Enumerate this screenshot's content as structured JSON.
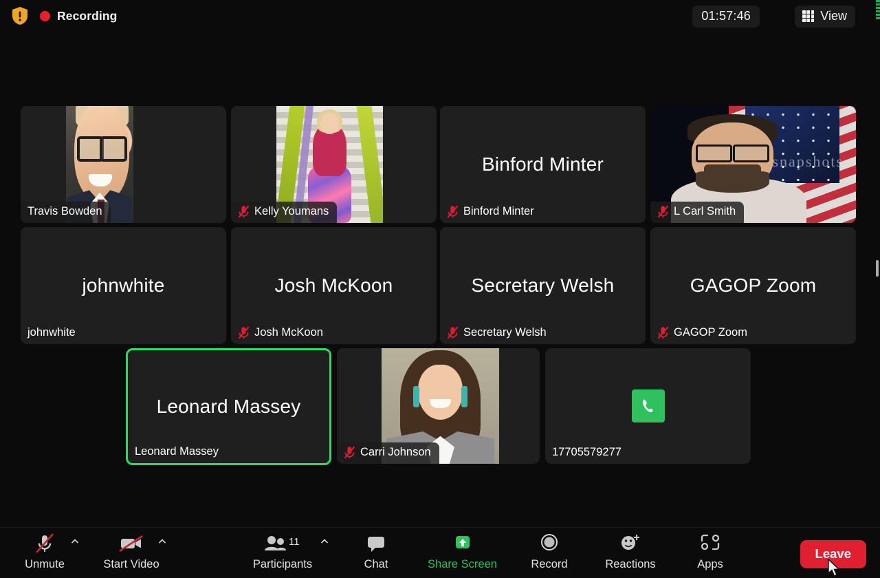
{
  "app": "Zoom Meeting",
  "topbar": {
    "shield_icon": "security-shield-icon",
    "recording_dot_icon": "recording-dot-icon",
    "recording_label": "Recording",
    "timer": "01:57:46",
    "view_label": "View",
    "view_icon": "grid-view-icon"
  },
  "colors": {
    "active_speaker_border": "#21e065",
    "mute_red": "#e02030",
    "share_green": "#2ec15d",
    "leave_red": "#e02030",
    "recording_red": "#e8202a",
    "tile_bg": "#1f1f1f",
    "app_bg": "#0b0b0b"
  },
  "gallery": {
    "participants": [
      {
        "name": "Travis Bowden",
        "display_name": "Travis Bowden",
        "big_name": "",
        "has_video": true,
        "muted": false,
        "active_speaker": false,
        "photo": "travis",
        "type": "video"
      },
      {
        "name": "Kelly Youmans",
        "display_name": "Kelly Youmans",
        "big_name": "",
        "has_video": true,
        "muted": true,
        "active_speaker": false,
        "photo": "kelly",
        "type": "video"
      },
      {
        "name": "Binford Minter",
        "display_name": "Binford Minter",
        "big_name": "Binford Minter",
        "has_video": false,
        "muted": true,
        "active_speaker": false,
        "photo": "",
        "type": "name"
      },
      {
        "name": "L Carl Smith",
        "display_name": "L Carl Smith",
        "big_name": "",
        "has_video": true,
        "muted": true,
        "active_speaker": false,
        "photo": "carl",
        "type": "video"
      },
      {
        "name": "johnwhite",
        "display_name": "johnwhite",
        "big_name": "johnwhite",
        "has_video": false,
        "muted": false,
        "active_speaker": false,
        "photo": "",
        "type": "name"
      },
      {
        "name": "Josh McKoon",
        "display_name": "Josh McKoon",
        "big_name": "Josh McKoon",
        "has_video": false,
        "muted": true,
        "active_speaker": false,
        "photo": "",
        "type": "name"
      },
      {
        "name": "Secretary Welsh",
        "display_name": "Secretary Welsh",
        "big_name": "Secretary Welsh",
        "has_video": false,
        "muted": true,
        "active_speaker": false,
        "photo": "",
        "type": "name"
      },
      {
        "name": "GAGOP Zoom",
        "display_name": "GAGOP Zoom",
        "big_name": "GAGOP Zoom",
        "has_video": false,
        "muted": true,
        "active_speaker": false,
        "photo": "",
        "type": "name"
      },
      {
        "name": "Leonard Massey",
        "display_name": "Leonard Massey",
        "big_name": "Leonard Massey",
        "has_video": false,
        "muted": false,
        "active_speaker": true,
        "photo": "",
        "type": "name"
      },
      {
        "name": "Carri Johnson",
        "display_name": "Carri Johnson",
        "big_name": "",
        "has_video": true,
        "muted": true,
        "active_speaker": false,
        "photo": "carri",
        "type": "video"
      },
      {
        "name": "17705579277",
        "display_name": "17705579277",
        "big_name": "",
        "has_video": false,
        "muted": false,
        "active_speaker": false,
        "photo": "",
        "type": "phone"
      }
    ]
  },
  "toolbar": {
    "items": [
      {
        "label": "Unmute",
        "icon": "microphone-muted-icon",
        "caret": true,
        "green": false
      },
      {
        "label": "Start Video",
        "icon": "camera-off-icon",
        "caret": true,
        "green": false
      },
      {
        "label": "Participants",
        "icon": "participants-icon",
        "caret": true,
        "green": false,
        "count": "11"
      },
      {
        "label": "Chat",
        "icon": "chat-bubble-icon",
        "caret": false,
        "green": false
      },
      {
        "label": "Share Screen",
        "icon": "share-screen-icon",
        "caret": false,
        "green": true
      },
      {
        "label": "Record",
        "icon": "record-circle-icon",
        "caret": false,
        "green": false
      },
      {
        "label": "Reactions",
        "icon": "reactions-smiley-icon",
        "caret": false,
        "green": false
      },
      {
        "label": "Apps",
        "icon": "apps-icon",
        "caret": false,
        "green": false
      }
    ],
    "leave_label": "Leave"
  }
}
